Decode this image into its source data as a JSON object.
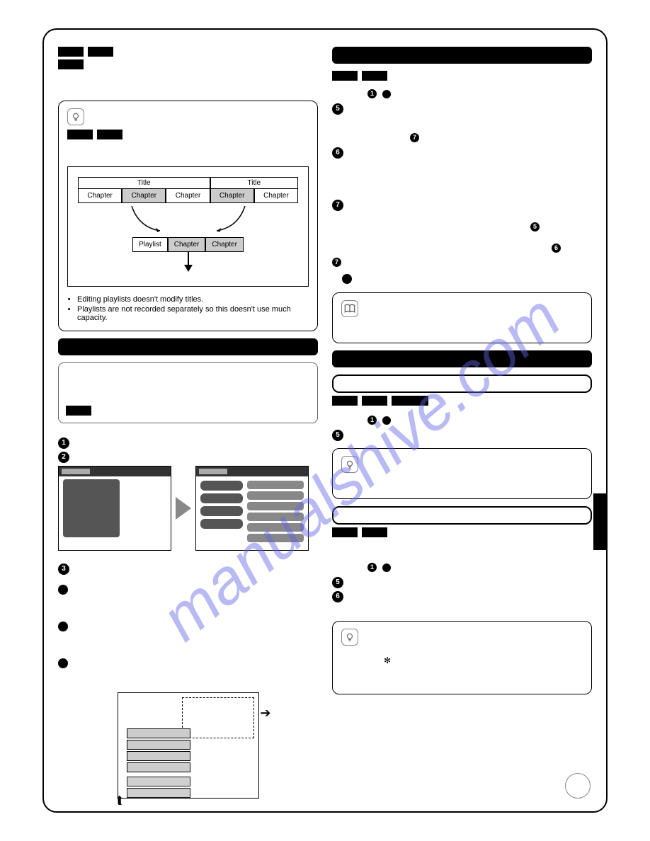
{
  "watermark": "manualshive.com",
  "diagram": {
    "title_label": "Title",
    "chapter_label": "Chapter",
    "playlist_label": "Playlist"
  },
  "bullets": {
    "b1": "Editing playlists doesn't modify titles.",
    "b2": "Playlists are not recorded separately so this doesn't use much capacity."
  },
  "asterisk": "✻"
}
